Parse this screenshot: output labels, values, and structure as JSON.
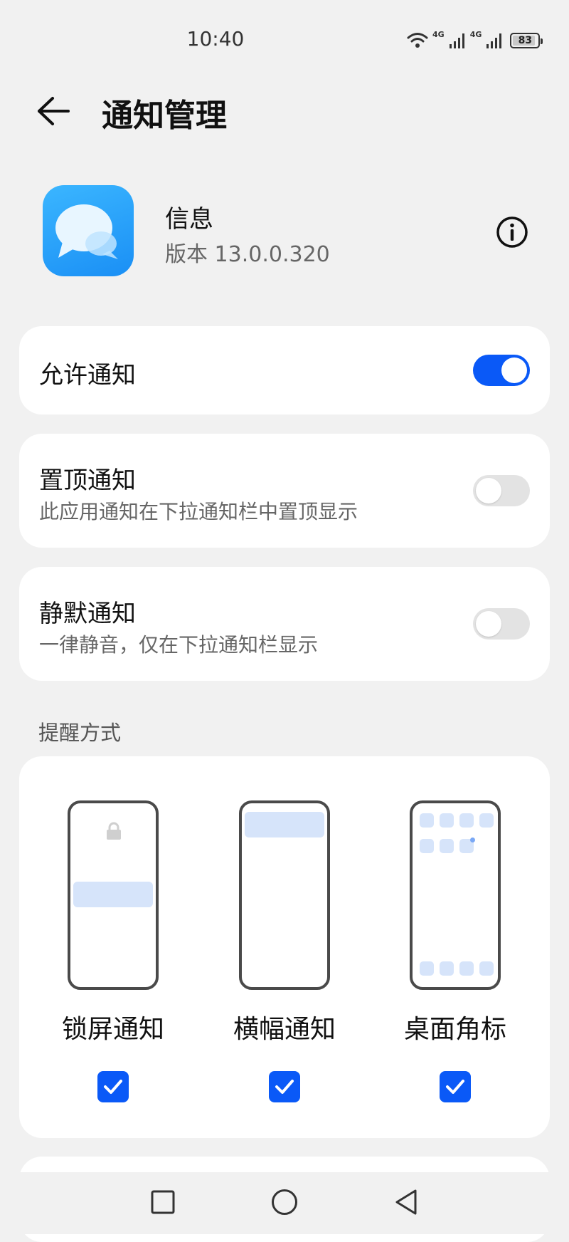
{
  "status_bar": {
    "time": "10:40",
    "signal1_label": "4G",
    "signal2_label": "4G",
    "battery": "83"
  },
  "header": {
    "title": "通知管理",
    "back_icon": "arrow-left-icon"
  },
  "app": {
    "name": "信息",
    "version": "版本 13.0.0.320",
    "icon": "message-bubble-icon",
    "info_icon": "info-circle-icon"
  },
  "settings": {
    "allow": {
      "label": "允许通知",
      "on": true
    },
    "pin": {
      "label": "置顶通知",
      "description": "此应用通知在下拉通知栏中置顶显示",
      "on": false
    },
    "silent": {
      "label": "静默通知",
      "description": "一律静音，仅在下拉通知栏显示",
      "on": false
    }
  },
  "reminder": {
    "section_label": "提醒方式",
    "options": [
      {
        "label": "锁屏通知",
        "checked": true
      },
      {
        "label": "横幅通知",
        "checked": true
      },
      {
        "label": "桌面角标",
        "checked": true
      }
    ]
  },
  "navbar": {
    "recent_icon": "square-icon",
    "home_icon": "circle-icon",
    "back_icon": "triangle-back-icon"
  },
  "colors": {
    "accent": "#0a59f7",
    "background": "#f1f1f1",
    "card": "#ffffff"
  }
}
